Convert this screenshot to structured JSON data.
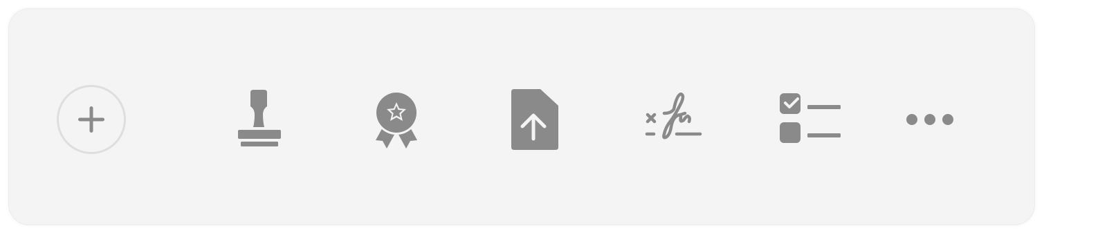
{
  "colors": {
    "panel_background": "#f4f4f4",
    "icon": "#8a8a8a",
    "add_ring": "#dedede"
  },
  "toolbar": {
    "tools": [
      {
        "name": "add",
        "icon": "plus-icon"
      },
      {
        "name": "stamp",
        "icon": "stamp-icon"
      },
      {
        "name": "certificate",
        "icon": "award-badge-icon"
      },
      {
        "name": "upload-file",
        "icon": "file-upload-icon"
      },
      {
        "name": "signature",
        "icon": "signature-icon"
      },
      {
        "name": "checklist",
        "icon": "checklist-icon"
      },
      {
        "name": "more",
        "icon": "more-horizontal-icon"
      }
    ]
  }
}
